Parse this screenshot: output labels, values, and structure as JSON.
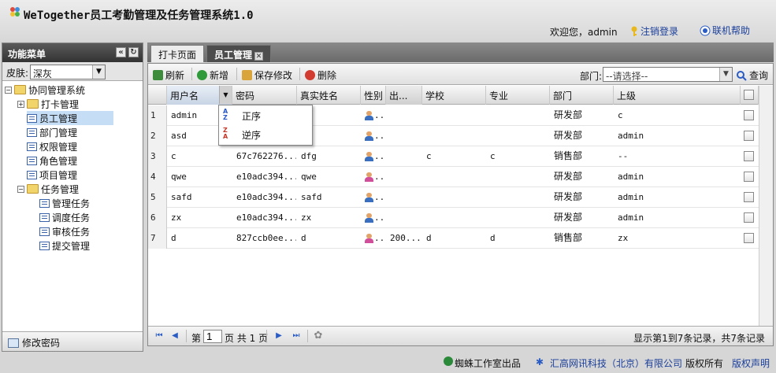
{
  "header": {
    "title": "WeTogether员工考勤管理及任务管理系统1.0",
    "welcome": "欢迎您，admin",
    "logout": "注销登录",
    "help": "联机帮助"
  },
  "sidebar": {
    "title": "功能菜单",
    "skin_label": "皮肤:",
    "skin_value": "深灰",
    "tree": [
      {
        "label": "协同管理系统",
        "type": "root"
      },
      {
        "label": "打卡管理",
        "type": "folder"
      },
      {
        "label": "员工管理",
        "type": "leaf",
        "selected": true
      },
      {
        "label": "部门管理",
        "type": "leaf"
      },
      {
        "label": "权限管理",
        "type": "leaf"
      },
      {
        "label": "角色管理",
        "type": "leaf"
      },
      {
        "label": "项目管理",
        "type": "leaf"
      },
      {
        "label": "任务管理",
        "type": "folder"
      },
      {
        "label": "管理任务",
        "type": "leaf"
      },
      {
        "label": "调度任务",
        "type": "leaf"
      },
      {
        "label": "审核任务",
        "type": "leaf"
      },
      {
        "label": "提交管理",
        "type": "leaf"
      }
    ],
    "change_pwd": "修改密码"
  },
  "tabs": [
    {
      "label": "打卡页面"
    },
    {
      "label": "员工管理",
      "active": true
    }
  ],
  "toolbar": {
    "refresh": "刷新",
    "add": "新增",
    "save": "保存修改",
    "delete": "删除",
    "dept_label": "部门:",
    "dept_placeholder": "--请选择--",
    "query": "查询"
  },
  "grid": {
    "columns": [
      "用户名",
      "密码",
      "真实姓名",
      "性别",
      "出...",
      "学校",
      "专业",
      "部门",
      "上级"
    ],
    "rows": [
      {
        "n": "1",
        "user": "admin",
        "pwd": "",
        "real": "in",
        "gender": "male",
        "birth": "",
        "school": "",
        "major": "",
        "dept": "研发部",
        "sup": "c"
      },
      {
        "n": "2",
        "user": "asd",
        "pwd": "",
        "real": "",
        "gender": "male",
        "birth": "",
        "school": "",
        "major": "",
        "dept": "研发部",
        "sup": "admin"
      },
      {
        "n": "3",
        "user": "c",
        "pwd": "67c762276...",
        "real": "dfg",
        "gender": "male",
        "birth": "",
        "school": "c",
        "major": "c",
        "dept": "销售部",
        "sup": "--"
      },
      {
        "n": "4",
        "user": "qwe",
        "pwd": "e10adc394...",
        "real": "qwe",
        "gender": "female",
        "birth": "",
        "school": "",
        "major": "",
        "dept": "研发部",
        "sup": "admin"
      },
      {
        "n": "5",
        "user": "safd",
        "pwd": "e10adc394...",
        "real": "safd",
        "gender": "male",
        "birth": "",
        "school": "",
        "major": "",
        "dept": "研发部",
        "sup": "admin"
      },
      {
        "n": "6",
        "user": "zx",
        "pwd": "e10adc394...",
        "real": "zx",
        "gender": "male",
        "birth": "",
        "school": "",
        "major": "",
        "dept": "研发部",
        "sup": "admin"
      },
      {
        "n": "7",
        "user": "d",
        "pwd": "827ccb0ee...",
        "real": "d",
        "gender": "female",
        "birth": "200...",
        "school": "d",
        "major": "d",
        "dept": "销售部",
        "sup": "zx"
      }
    ],
    "gender_suffix": "..."
  },
  "sort_menu": {
    "asc": "正序",
    "desc": "逆序"
  },
  "pager": {
    "page_prefix": "第",
    "page_value": "1",
    "page_suffix": "页 共 1 页",
    "summary": "显示第1到7条记录，共7条记录"
  },
  "footer": {
    "studio": "蜘蛛工作室出品",
    "company": "汇高网讯科技（北京）有限公司",
    "rights": "版权所有",
    "statement": "版权声明"
  }
}
